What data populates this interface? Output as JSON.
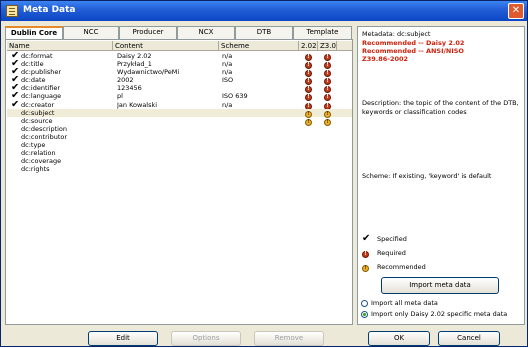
{
  "window": {
    "title": "Meta Data"
  },
  "tabs": [
    {
      "label": "Dublin Core"
    },
    {
      "label": "NCC"
    },
    {
      "label": "Producer"
    },
    {
      "label": "NCX"
    },
    {
      "label": "DTB"
    },
    {
      "label": "Template"
    }
  ],
  "table": {
    "headers": {
      "name": "Name",
      "content": "Content",
      "scheme": "Scheme",
      "m1": "2.02",
      "m2": "Z3.0"
    },
    "rows": [
      {
        "check": "✔",
        "name": "dc:format",
        "content": "Daisy 2.02",
        "scheme": "n/a",
        "m1": "req",
        "m2": "req"
      },
      {
        "check": "✔",
        "name": "dc:title",
        "content": "Przykład_1",
        "scheme": "n/a",
        "m1": "req",
        "m2": "req"
      },
      {
        "check": "✔",
        "name": "dc:publisher",
        "content": "Wydawnictwo/PeMi",
        "scheme": "n/a",
        "m1": "req",
        "m2": "req"
      },
      {
        "check": "✔",
        "name": "dc:date",
        "content": "2002",
        "scheme": "ISO",
        "m1": "req",
        "m2": "req"
      },
      {
        "check": "✔",
        "name": "dc:identifier",
        "content": "123456",
        "scheme": "",
        "m1": "req",
        "m2": "req"
      },
      {
        "check": "✔",
        "name": "dc:language",
        "content": "pl",
        "scheme": "ISO 639",
        "m1": "req",
        "m2": "req"
      },
      {
        "check": "✔",
        "name": "dc:creator",
        "content": "Jan Kowalski",
        "scheme": "n/a",
        "m1": "req",
        "m2": "req"
      },
      {
        "check": "",
        "name": "dc:subject",
        "content": "",
        "scheme": "",
        "m1": "rec",
        "m2": "rec",
        "selected": true
      },
      {
        "check": "",
        "name": "dc:source",
        "content": "",
        "scheme": "",
        "m1": "rec",
        "m2": "rec"
      },
      {
        "check": "",
        "name": "dc:description",
        "content": "",
        "scheme": "",
        "m1": "",
        "m2": ""
      },
      {
        "check": "",
        "name": "dc:contributor",
        "content": "",
        "scheme": "",
        "m1": "",
        "m2": ""
      },
      {
        "check": "",
        "name": "dc:type",
        "content": "",
        "scheme": "",
        "m1": "",
        "m2": ""
      },
      {
        "check": "",
        "name": "dc:relation",
        "content": "",
        "scheme": "",
        "m1": "",
        "m2": ""
      },
      {
        "check": "",
        "name": "dc:coverage",
        "content": "",
        "scheme": "",
        "m1": "",
        "m2": ""
      },
      {
        "check": "",
        "name": "dc:rights",
        "content": "",
        "scheme": "",
        "m1": "",
        "m2": ""
      }
    ]
  },
  "info": {
    "heading": "Metadata: dc:subject",
    "recommended_1": "Recommended -- Daisy 2.02",
    "recommended_2": "Recommended -- ANSI/NISO",
    "recommended_3": "Z39.86-2002",
    "description": "Description: the topic of the content of the DTB, keywords or classification codes",
    "scheme_note": "Scheme: If existing, 'keyword' is default"
  },
  "legend": {
    "specified": "Specified",
    "required": "Required",
    "recommended": "Recommended"
  },
  "buttons": {
    "import_meta": "Import meta data",
    "edit": "Edit",
    "options": "Options",
    "remove": "Remove",
    "ok": "OK",
    "cancel": "Cancel"
  },
  "options": {
    "import_all": "Import all meta data",
    "import_daisy": "Import only Daisy 2.02 specific meta data"
  },
  "icons": {
    "window": "document-icon",
    "close": "close-icon",
    "specified": "check-icon",
    "required": "exclamation-red-icon",
    "recommended": "exclamation-yellow-icon"
  },
  "colors": {
    "title_bar": "#0c46c4",
    "required": "#c63a1e",
    "recommended": "#e8b12a",
    "recommended_text": "#cc1f0a"
  }
}
